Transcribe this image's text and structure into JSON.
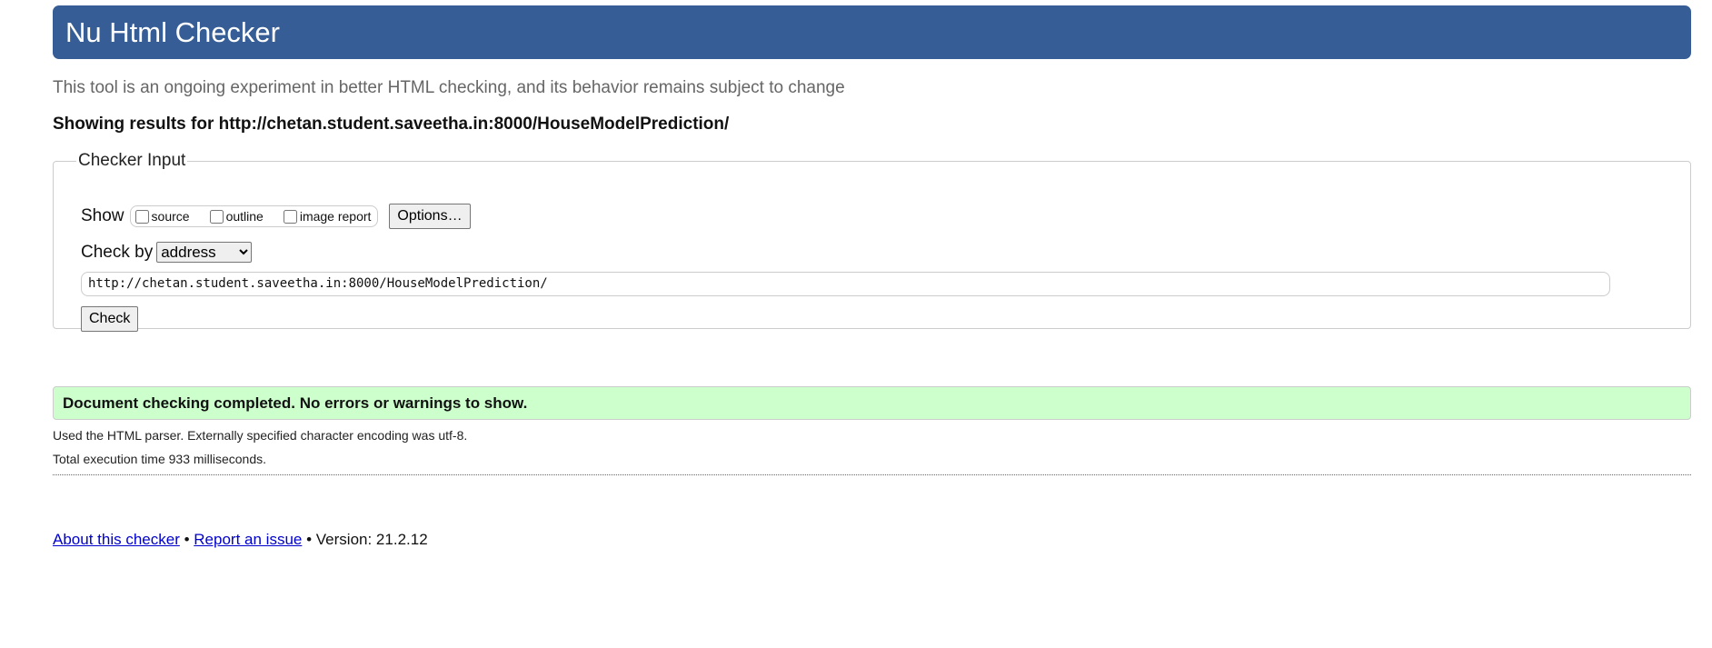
{
  "header": {
    "title": "Nu Html Checker"
  },
  "subtitle": "This tool is an ongoing experiment in better HTML checking, and its behavior remains subject to change",
  "showing": "Showing results for http://chetan.student.saveetha.in:8000/HouseModelPrediction/",
  "checker_input": {
    "legend": "Checker Input",
    "show_label": "Show",
    "options": [
      {
        "label": "source",
        "checked": false
      },
      {
        "label": "outline",
        "checked": false
      },
      {
        "label": "image report",
        "checked": false
      }
    ],
    "options_button": "Options…",
    "check_by_label": "Check by",
    "check_by_value": "address",
    "url_value": "http://chetan.student.saveetha.in:8000/HouseModelPrediction/",
    "check_button": "Check"
  },
  "result": {
    "message": "Document checking completed. No errors or warnings to show.",
    "parser_info": "Used the HTML parser. Externally specified character encoding was utf-8.",
    "execution_time": "Total execution time 933 milliseconds."
  },
  "footer": {
    "about": "About this checker",
    "separator": "•",
    "report": "Report an issue",
    "version": "Version: 21.2.12"
  },
  "colors": {
    "header_bg": "#365d95",
    "success_bg": "#ccffcc",
    "link": "#0000cc"
  }
}
